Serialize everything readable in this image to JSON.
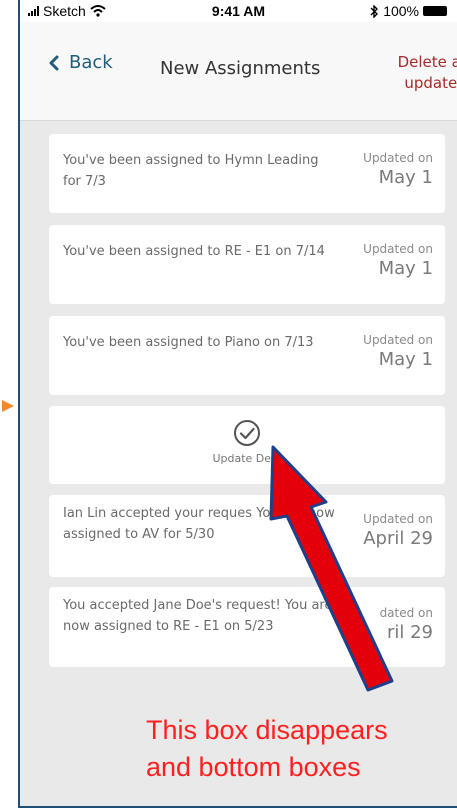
{
  "status_bar": {
    "carrier": "Sketch",
    "time": "9:41 AM",
    "battery": "100%"
  },
  "nav": {
    "back_label": "Back",
    "title": "New Assignments",
    "delete_all_line1": "Delete al",
    "delete_all_line2": "updates"
  },
  "cards": [
    {
      "text": "You've been assigned to Hymn Leading for 7/3",
      "date_label": "Updated on",
      "date_value": "May 1"
    },
    {
      "text": "You've been assigned to RE - E1 on 7/14",
      "date_label": "Updated on",
      "date_value": "May 1"
    },
    {
      "text": "You've been assigned to Piano on 7/13",
      "date_label": "Updated on",
      "date_value": "May 1"
    },
    {
      "text": "Ian Lin accepted your reques You are now assigned to AV for 5/30",
      "date_label": "Updated on",
      "date_value": "April 29"
    },
    {
      "text": "You accepted Jane Doe's request! You are now assigned to RE - E1 on 5/23",
      "date_label": "dated on",
      "date_value": "ril 29"
    }
  ],
  "deleted_card": {
    "label": "Update De     d"
  },
  "annotation": {
    "line1": "This box disappears",
    "line2": "and bottom boxes"
  },
  "colors": {
    "accent": "#1f5e7a",
    "delete": "#a52a2a",
    "annotation": "#ff1f1f",
    "arrow": "#e3000b",
    "marker": "#f0892f"
  }
}
